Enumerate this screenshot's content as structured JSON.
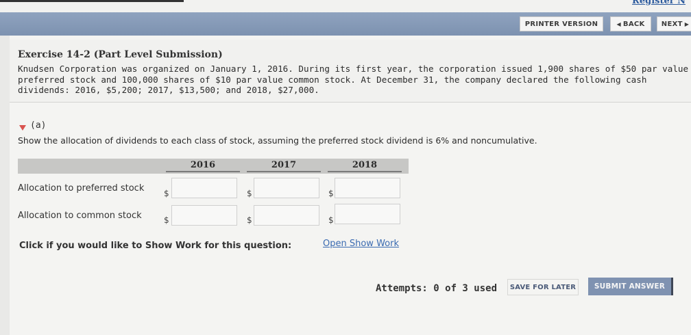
{
  "header": {
    "partial_link": "Register N",
    "printer_label": "PRINTER VERSION",
    "back_label": "BACK",
    "next_label": "NEXT"
  },
  "exercise": {
    "title": "Exercise 14-2 (Part Level Submission)",
    "text": "Knudsen Corporation was organized on January 1, 2016. During its first year, the corporation issued 1,900 shares of $50 par value preferred stock and 100,000 shares of $10 par value common stock. At December 31, the company declared the following cash dividends: 2016, $5,200; 2017, $13,500; and 2018, $27,000."
  },
  "part": {
    "label": "(a)",
    "question": "Show the allocation of dividends to each class of stock, assuming the preferred stock dividend is 6% and noncumulative."
  },
  "table": {
    "columns": [
      "2016",
      "2017",
      "2018"
    ],
    "rows": [
      {
        "label": "Allocation to preferred stock",
        "currency": "$"
      },
      {
        "label": "Allocation to common stock",
        "currency": "$"
      }
    ]
  },
  "show_work": {
    "prompt": "Click if you would like to Show Work for this question:",
    "link": "Open Show Work"
  },
  "footer": {
    "attempts": "Attempts: 0 of 3 used",
    "save_label": "SAVE FOR LATER",
    "submit_label": "SUBMIT ANSWER"
  }
}
